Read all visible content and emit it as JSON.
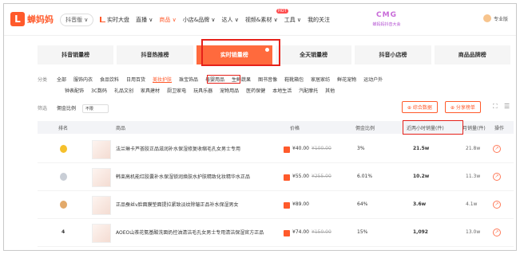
{
  "brand": {
    "logo_glyph": "L",
    "name": "蝉妈妈",
    "accent": "#ff5a2b"
  },
  "platform": "抖音版 ∨",
  "nav": {
    "items": [
      {
        "label": "实时大盘",
        "type": "realtime"
      },
      {
        "label": "直播 ∨",
        "type": "normal"
      },
      {
        "label": "商品 ∨",
        "type": "active"
      },
      {
        "label": "小店&品牌 ∨",
        "type": "normal"
      },
      {
        "label": "达人 ∨",
        "type": "normal"
      },
      {
        "label": "视频&素材 ∨",
        "type": "normal"
      },
      {
        "label": "工具 ∨",
        "type": "normal"
      },
      {
        "label": "我的关注",
        "type": "normal"
      }
    ],
    "hot_badge": "HOT"
  },
  "banner": {
    "main": "CMG",
    "sub": "蝉妈妈抖音大会"
  },
  "user": {
    "label": "专业版"
  },
  "tabs": [
    {
      "label": "抖音销量榜",
      "active": false
    },
    {
      "label": "抖音热推榜",
      "active": false
    },
    {
      "label": "实时销量榜",
      "active": true
    },
    {
      "label": "全天销量榜",
      "active": false
    },
    {
      "label": "抖音小店榜",
      "active": false
    },
    {
      "label": "商品品牌榜",
      "active": false
    }
  ],
  "filters": {
    "category_label": "分类",
    "categories_row1": [
      "全部",
      "服饰内衣",
      "食品饮料",
      "日用百货",
      "美妆护肤",
      "珠宝饰品",
      "母婴用品",
      "生鲜蔬果",
      "图书音像",
      "鞋靴箱包",
      "家居家纺",
      "鲜花宠物",
      "运动户外"
    ],
    "selected_category": "美妆护肤",
    "categories_row2": [
      "钟表配饰",
      "3C数码",
      "礼品文创",
      "家具建材",
      "厨卫家电",
      "玩具乐器",
      "宠物用品",
      "医药保健",
      "本地生活",
      "汽配摩托",
      "其他"
    ],
    "filter_label": "筛选",
    "commission_label": "佣金比例",
    "commission_value": "不限",
    "btn_compare": "⊕ 综合数据",
    "btn_share": "⊕ 分享榜单",
    "expand_icon": "⛶",
    "menu_icon": "☰"
  },
  "table": {
    "headers": {
      "rank": "排名",
      "product": "商品",
      "price": "价格",
      "commission": "佣金比例",
      "recent_sales": "近两小时销量(件)",
      "month_sales": "月销量(件)",
      "action": "操作"
    },
    "rows": [
      {
        "rank": "",
        "medal_color": "#f5c02c",
        "title": "法兰琳卡芦荟胶正品滋润补水保湿修复收缩毛孔女男士专用",
        "price": "¥40.00",
        "orig_price": "¥100.00",
        "commission": "3%",
        "recent_sales": "21.5w",
        "month_sales": "21.8w"
      },
      {
        "rank": "",
        "medal_color": "#c9ced6",
        "title": "韩束高机能红胶囊补水保湿锁润焕肤水护肤精致化妆精华水正品",
        "price": "¥55.00",
        "orig_price": "¥255.00",
        "commission": "6.01%",
        "recent_sales": "10.2w",
        "month_sales": "11.3w"
      },
      {
        "rank": "",
        "medal_color": "#e2a96a",
        "title": "正品蚕丝v脸面膜垫面提拉紧致淡纹除皱正品补水保湿男女",
        "price": "¥89.00",
        "orig_price": "",
        "commission": "64%",
        "recent_sales": "3.6w",
        "month_sales": "4.1w"
      },
      {
        "rank": "4",
        "medal_color": "",
        "title": "AOEO山茶花氨基酸洗面奶控油清洁毛孔女男士专用清洁保湿官方正品",
        "price": "¥74.00",
        "orig_price": "¥150.00",
        "commission": "15%",
        "recent_sales": "1,092",
        "month_sales": "13.0w"
      }
    ],
    "action_glyph": "↗"
  }
}
